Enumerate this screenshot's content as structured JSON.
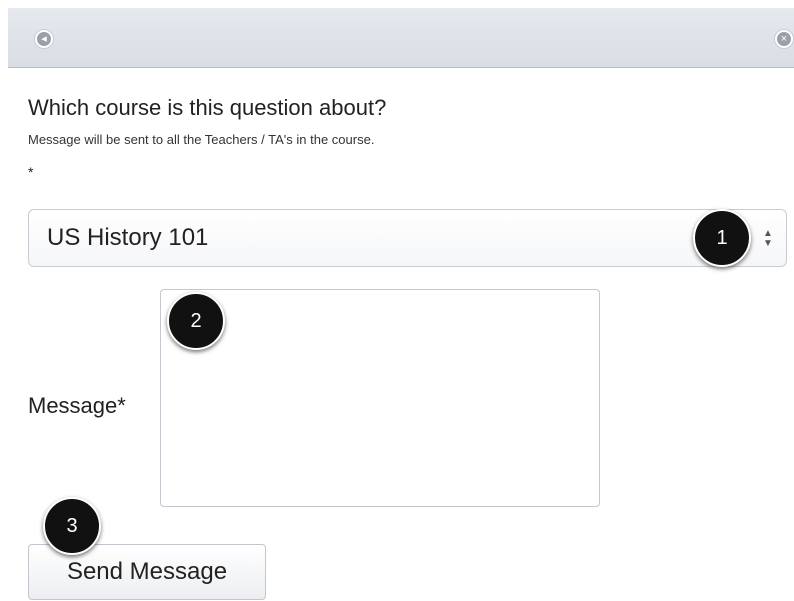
{
  "window": {
    "back_icon": "back-arrow-icon",
    "close_icon": "close-x-icon",
    "back_glyph": "◂",
    "close_glyph": "×"
  },
  "form": {
    "heading": "Which course is this question about?",
    "subtext": "Message will be sent to all the Teachers / TA's in the course.",
    "required_marker": "*",
    "course_select": {
      "selected": "US History 101",
      "arrow_up": "▲",
      "arrow_down": "▼"
    },
    "message_label": "Message*",
    "message_value": "",
    "send_button": "Send Message"
  },
  "callouts": [
    "1",
    "2",
    "3"
  ],
  "colors": {
    "titlebar": "#dde1e7",
    "callout_bg": "#111111",
    "callout_text": "#ffffff"
  }
}
